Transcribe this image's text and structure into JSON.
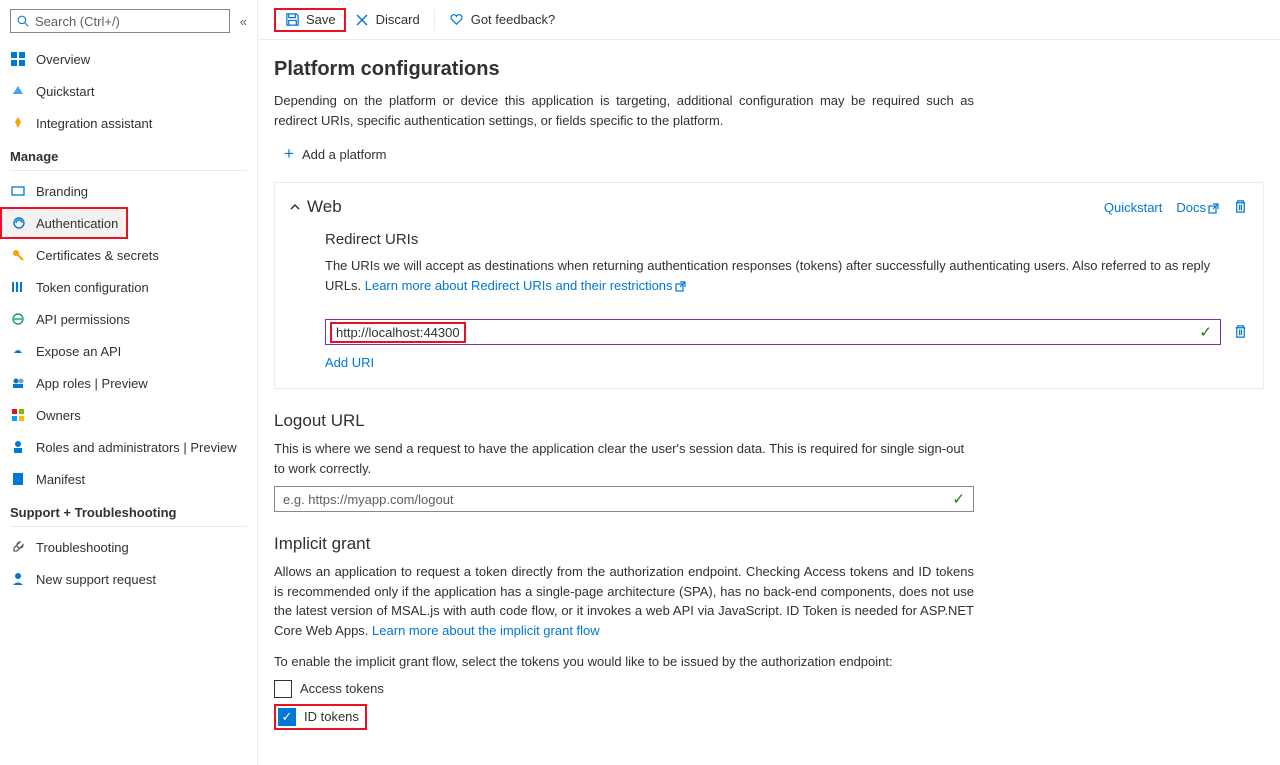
{
  "search": {
    "placeholder": "Search (Ctrl+/)"
  },
  "sidebar": {
    "items": [
      {
        "label": "Overview"
      },
      {
        "label": "Quickstart"
      },
      {
        "label": "Integration assistant"
      }
    ],
    "manage_label": "Manage",
    "manage": [
      {
        "label": "Branding"
      },
      {
        "label": "Authentication"
      },
      {
        "label": "Certificates & secrets"
      },
      {
        "label": "Token configuration"
      },
      {
        "label": "API permissions"
      },
      {
        "label": "Expose an API"
      },
      {
        "label": "App roles | Preview"
      },
      {
        "label": "Owners"
      },
      {
        "label": "Roles and administrators | Preview"
      },
      {
        "label": "Manifest"
      }
    ],
    "support_label": "Support + Troubleshooting",
    "support": [
      {
        "label": "Troubleshooting"
      },
      {
        "label": "New support request"
      }
    ]
  },
  "toolbar": {
    "save": "Save",
    "discard": "Discard",
    "feedback": "Got feedback?"
  },
  "page": {
    "title": "Platform configurations",
    "intro": "Depending on the platform or device this application is targeting, additional configuration may be required such as redirect URIs, specific authentication settings, or fields specific to the platform.",
    "add_platform": "Add a platform"
  },
  "web": {
    "title": "Web",
    "quickstart": "Quickstart",
    "docs": "Docs",
    "redirect_title": "Redirect URIs",
    "redirect_desc": "The URIs we will accept as destinations when returning authentication responses (tokens) after successfully authenticating users. Also referred to as reply URLs. ",
    "redirect_learn": "Learn more about Redirect URIs and their restrictions",
    "url_value": "http://localhost:44300",
    "add_uri": "Add URI"
  },
  "logout": {
    "title": "Logout URL",
    "desc": "This is where we send a request to have the application clear the user's session data. This is required for single sign-out to work correctly.",
    "placeholder": "e.g. https://myapp.com/logout"
  },
  "implicit": {
    "title": "Implicit grant",
    "desc": "Allows an application to request a token directly from the authorization endpoint. Checking Access tokens and ID tokens is recommended only if the application has a single-page architecture (SPA), has no back-end components, does not use the latest version of MSAL.js with auth code flow, or it invokes a web API via JavaScript. ID Token is needed for ASP.NET Core Web Apps. ",
    "learn": "Learn more about the implicit grant flow",
    "enable_text": "To enable the implicit grant flow, select the tokens you would like to be issued by the authorization endpoint:",
    "access": "Access tokens",
    "id": "ID tokens"
  }
}
